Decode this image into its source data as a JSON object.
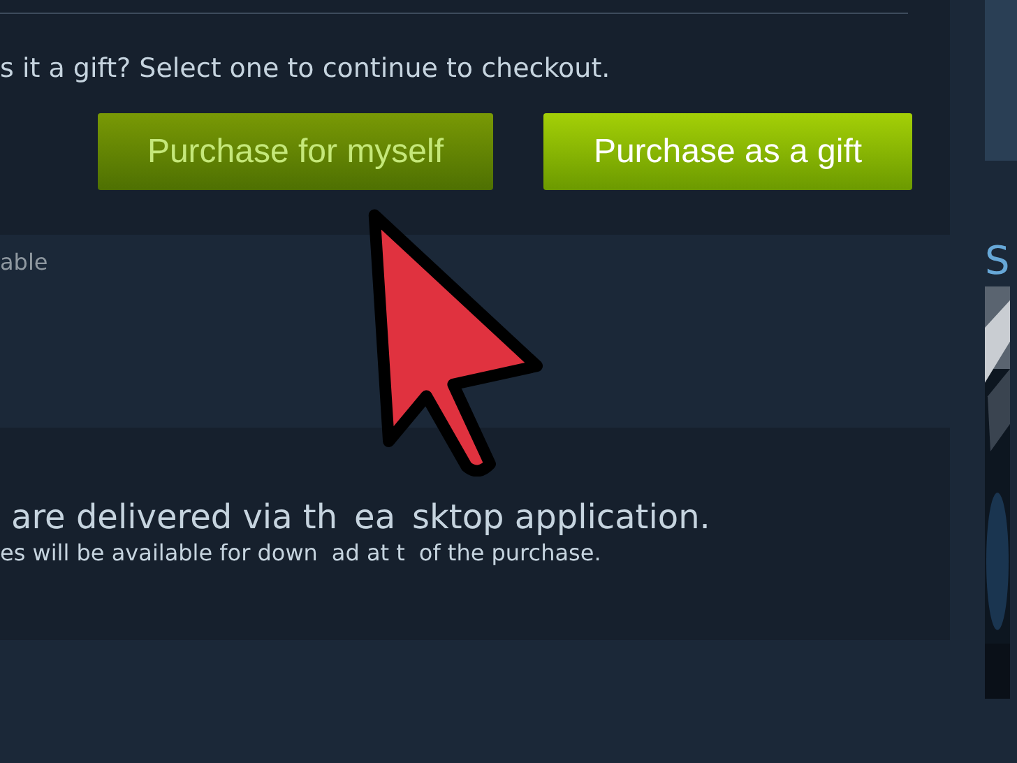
{
  "prompt": "s it a gift? Select one to continue to checkout.",
  "buttons": [
    {
      "label": "Purchase for myself",
      "hovered": true
    },
    {
      "label": "Purchase as a gift",
      "hovered": false
    }
  ],
  "note": "able",
  "side_heading": "S",
  "delivery_line_pieces": [
    "are delivered via th",
    "ea",
    "sktop application."
  ],
  "download_line_pieces": [
    "es will be available for down",
    "ad at t",
    "of the purchase."
  ]
}
